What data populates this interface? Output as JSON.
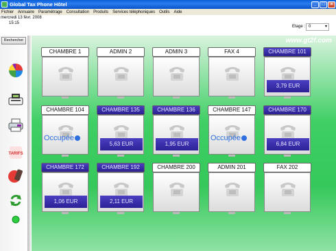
{
  "window": {
    "title": "Global Tax Phone Hôtel"
  },
  "menu": [
    "Fichier",
    "Annuaire",
    "Paramétrage",
    "Consultation",
    "Produits",
    "Services téléphoniques",
    "Outils",
    "Aide"
  ],
  "info": {
    "date": "mercredi 13 févr. 2008",
    "time": "15:15",
    "etage_label": "Etage :",
    "etage_value": "0"
  },
  "sidebar": {
    "search_label": "Rechercher",
    "tarifs_label": "TARIFS"
  },
  "site_url": "www.gt2f.com",
  "rooms": [
    {
      "name": "CHAMBRE 1",
      "status": "free",
      "text": ""
    },
    {
      "name": "ADMIN 2",
      "status": "free",
      "text": ""
    },
    {
      "name": "ADMIN 3",
      "status": "free",
      "text": ""
    },
    {
      "name": "FAX 4",
      "status": "free",
      "text": ""
    },
    {
      "name": "CHAMBRE 101",
      "status": "busy",
      "text": "3,79 EUR"
    },
    {
      "name": "CHAMBRE 104",
      "status": "occupied",
      "text": "Occupée"
    },
    {
      "name": "CHAMBRE 135",
      "status": "busy",
      "text": "5,63 EUR"
    },
    {
      "name": "CHAMBRE 136",
      "status": "busy",
      "text": "1,95 EUR"
    },
    {
      "name": "CHAMBRE 147",
      "status": "occupied",
      "text": "Occupée"
    },
    {
      "name": "CHAMBRE 170",
      "status": "busy",
      "text": "6,84 EUR"
    },
    {
      "name": "CHAMBRE 172",
      "status": "busy",
      "text": "1,06 EUR"
    },
    {
      "name": "CHAMBRE 192",
      "status": "busy",
      "text": "2,11 EUR"
    },
    {
      "name": "CHAMBRE 200",
      "status": "free",
      "text": ""
    },
    {
      "name": "ADMIN 201",
      "status": "free",
      "text": ""
    },
    {
      "name": "FAX 202",
      "status": "free",
      "text": ""
    }
  ],
  "colors": {
    "accent_busy": "#2c2196",
    "occupied_text": "#2d6fe0",
    "background_green": "#35c85a"
  }
}
